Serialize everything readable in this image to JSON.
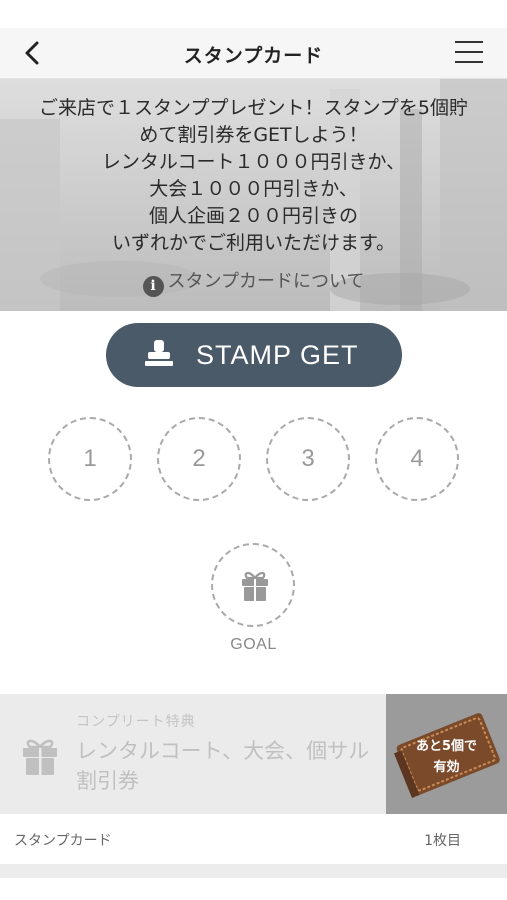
{
  "header": {
    "title": "スタンプカード"
  },
  "hero": {
    "lines": [
      "ご来店で１スタンププレゼント！スタンプを5個貯",
      "めて割引券をGETしよう！",
      "レンタルコート１０００円引きか、",
      "大会１０００円引きか、",
      "個人企画２００円引きの",
      "いずれかでご利用いただけます。"
    ],
    "about_link": "スタンプカードについて"
  },
  "stamp_button": {
    "label": "STAMP GET"
  },
  "slots": [
    "1",
    "2",
    "3",
    "4"
  ],
  "goal": {
    "label": "GOAL"
  },
  "complete": {
    "small_label": "コンプリート特典",
    "reward_line1": "レンタルコート、大会、個サル",
    "reward_line2": "割引券",
    "remaining_line1": "あと5個で",
    "remaining_line2": "有効"
  },
  "footer": {
    "card_label": "スタンプカード",
    "card_count": "1枚目"
  },
  "colors": {
    "button_bg": "#4a5a68",
    "slot_border": "#aaaaaa",
    "header_bg": "#f6f6f6",
    "complete_bg": "#ebebeb"
  }
}
